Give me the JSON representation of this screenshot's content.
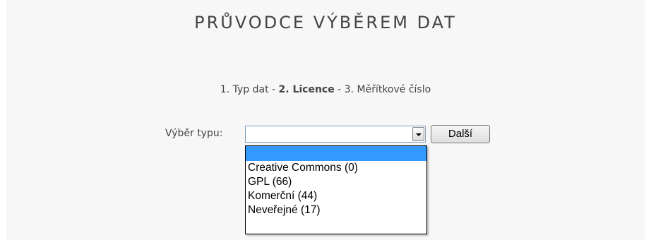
{
  "title": "PRŮVODCE VÝBĚREM DAT",
  "steps": {
    "step1": "1. Typ dat",
    "sep1": " - ",
    "step2": "2. Licence",
    "sep2": " - ",
    "step3": "3. Měřítkové číslo"
  },
  "form": {
    "type_label": "Výběr typu:",
    "selected_value": "",
    "next_button": "Další"
  },
  "dropdown": {
    "options": [
      "",
      "Creative Commons (0)",
      "GPL (66)",
      "Komerční (44)",
      "Neveřejné (17)"
    ],
    "highlighted_index": 0
  },
  "colors": {
    "highlight": "#3399ff",
    "panel_background": "#f7f7f7",
    "text": "#444444"
  }
}
